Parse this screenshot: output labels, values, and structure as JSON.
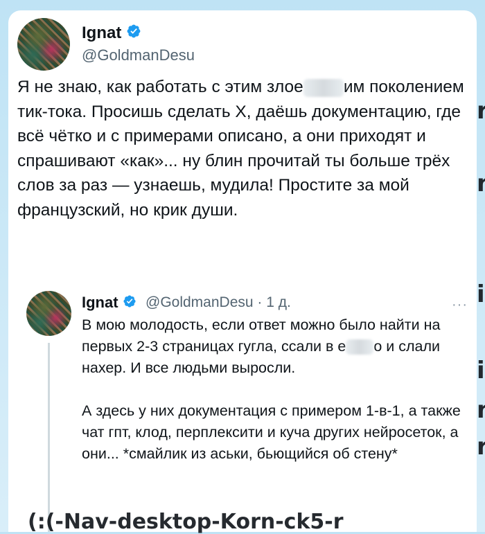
{
  "background": {
    "fragments": [
      "r",
      "n",
      "i",
      "i",
      "n",
      "r",
      "(:(-Nav-desktop-Korn-ck5-r"
    ]
  },
  "main_tweet": {
    "author_name": "Ignat",
    "handle": "@GoldmanDesu",
    "text_part1": "Я не знаю, как работать с этим злое",
    "text_part2": "им поколением тик-тока. Просишь сделать Х, даёшь документацию, где всё чётко и с примерами описано, а они приходят и спрашивают «как»... ну блин прочитай ты больше трёх слов за раз — узнаешь, мудила! Простите за мой французский, но крик души."
  },
  "quoted_tweet": {
    "author_name": "Ignat",
    "handle": "@GoldmanDesu",
    "separator": "·",
    "time": "1 д.",
    "more": "···",
    "para1_part1": "В мою молодость, если ответ можно было найти на первых 2-3 страницах гугла, ссали в е",
    "para1_part2": "о и слали нахер. И все людьми выросли.",
    "para2": "А здесь у них документация с примером 1-в-1, а также чат гпт, клод, перплексити и куча других нейросеток, а они... *смайлик из аськи, бьющийся об стену*"
  },
  "colors": {
    "verified": "#1d9bf0",
    "text": "#0f1419",
    "secondary": "#536471"
  }
}
